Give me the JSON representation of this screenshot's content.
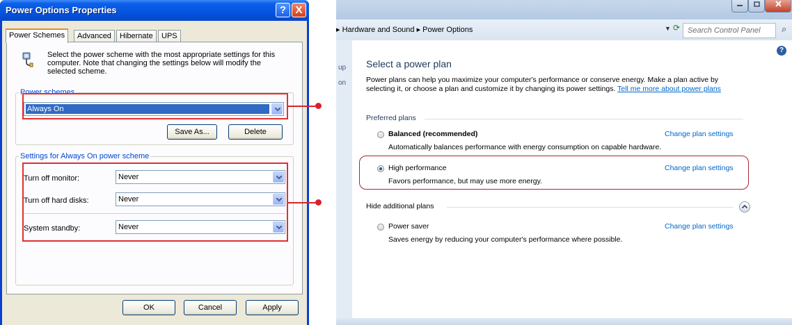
{
  "xp_dialog": {
    "title": "Power Options Properties",
    "tabs": [
      "Power Schemes",
      "Advanced",
      "Hibernate",
      "UPS"
    ],
    "intro": "Select the power scheme with the most appropriate settings for this computer. Note that changing the settings below will modify the selected scheme.",
    "power_schemes_legend": "Power schemes",
    "selected_scheme": "Always On",
    "save_as_label": "Save As...",
    "delete_label": "Delete",
    "settings_legend": "Settings for Always On power scheme",
    "settings": [
      {
        "label": "Turn off monitor:",
        "value": "Never"
      },
      {
        "label": "Turn off hard disks:",
        "value": "Never"
      },
      {
        "label": "System standby:",
        "value": "Never"
      }
    ],
    "ok_label": "OK",
    "cancel_label": "Cancel",
    "apply_label": "Apply",
    "help_glyph": "?",
    "close_glyph": "X"
  },
  "win7_panel": {
    "breadcrumb": "▸ Hardware and Sound ▸ Power Options",
    "search_placeholder": "Search Control Panel",
    "nav_snippets": [
      "up",
      "on"
    ],
    "heading": "Select a power plan",
    "description": "Power plans can help you maximize your computer's performance or conserve energy. Make a plan active by selecting it, or choose a plan and customize it by changing its power settings.",
    "tell_me_link": "Tell me more about power plans",
    "preferred_plans_label": "Preferred plans",
    "hide_plans_label": "Hide additional plans",
    "plans": [
      {
        "name": "Balanced (recommended)",
        "description": "Automatically balances performance with energy consumption on capable hardware.",
        "link": "Change plan settings",
        "selected": false
      },
      {
        "name": "High performance",
        "description": "Favors performance, but may use more energy.",
        "link": "Change plan settings",
        "selected": true
      },
      {
        "name": "Power saver",
        "description": "Saves energy by reducing your computer's performance where possible.",
        "link": "Change plan settings",
        "selected": false
      }
    ]
  },
  "colors": {
    "highlight_red": "#e0302f",
    "xp_title_blue": "#0654e0",
    "link_blue": "#0066cc",
    "selection_blue": "#316ac5"
  }
}
